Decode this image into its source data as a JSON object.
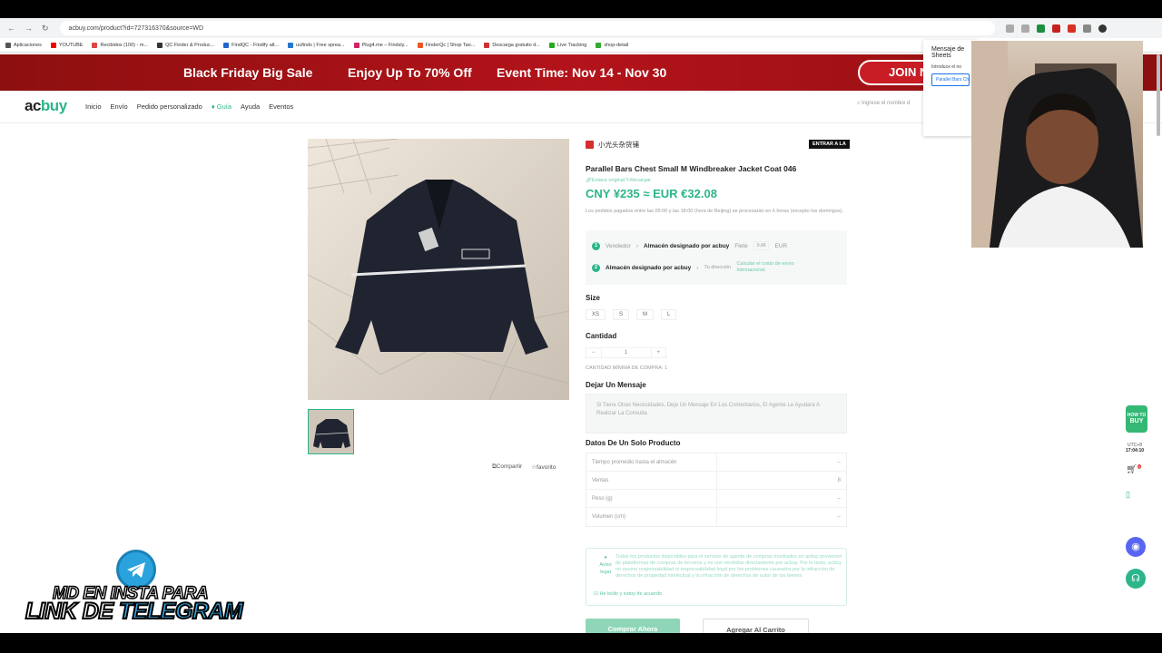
{
  "browser": {
    "url": "acbuy.com/product?id=727316370&source=WD",
    "bookmarks": [
      "Aplicaciones",
      "YOUTUBE",
      "Recibidos (100) - m...",
      "QC Finder & Produc...",
      "FindQC - Findify alt...",
      "uufinds | Free sprea...",
      "Plug4.me – Findsly...",
      "FinderQc | Shop Tao...",
      "Descarga gratuito d...",
      "Live Tracking",
      "shop-detail"
    ]
  },
  "banner": {
    "sale": "Black Friday Big Sale",
    "discount": "Enjoy Up To 70% Off",
    "event": "Event Time: Nov 14 - Nov 30",
    "join": "JOIN N"
  },
  "nav": {
    "logo_a": "ac",
    "logo_b": "buy",
    "items": [
      "Inicio",
      "Envío",
      "Pedido personalizado",
      "Guía",
      "Ayuda",
      "Eventos"
    ],
    "search_placeholder": "Ingrese el nombre d"
  },
  "product": {
    "store_name": "小光头杂货铺",
    "enter_store": "ENTRAR A LA",
    "title": "Parallel Bars Chest Small M Windbreaker Jacket Coat 046",
    "link_original": "Enlace original",
    "link_reload": "Recargar",
    "price": "CNY ¥235 ≈ EUR €32.08",
    "note": "Los pedidos pagados entre las 09:00 y las 18:00 (hora de Beijing) se procesarán en 6 horas (excepto los domingos).",
    "ship_row1": {
      "num": "1",
      "seller": "Vendedor",
      "warehouse": "Almacén designado por acbuy",
      "flete": "Flete",
      "amount": "0,48",
      "currency": "EUR"
    },
    "ship_row2": {
      "num": "2",
      "warehouse": "Almacén designado por acbuy",
      "dir": "Tu dirección",
      "calc": "Calcular el costo de envío internacional"
    },
    "size_label": "Size",
    "sizes": [
      "XS",
      "S",
      "M",
      "L"
    ],
    "qty_label": "Cantidad",
    "qty_minus": "−",
    "qty_value": "1",
    "qty_plus": "+",
    "min_qty": "CANTIDAD MÍNIMA DE COMPRA: 1",
    "msg_label": "Dejar Un Mensaje",
    "msg_placeholder": "Si Tiene Otras Necesidades, Deje Un Mensaje En Los Comentarios, El Agente Le Ayudará A Realizar La Consulta",
    "data_label": "Datos De Un Solo Producto",
    "data_rows": [
      {
        "k": "Tiempo promedio hasta el almacén",
        "v": "--"
      },
      {
        "k": "Ventas",
        "v": "8"
      },
      {
        "k": "Peso (g)",
        "v": "--"
      },
      {
        "k": "Volumen (cm)",
        "v": "--"
      }
    ],
    "legal_head": "Aviso legal",
    "legal_text": "Todos los productos disponibles para el servicio de agente de compras mostrados en acbuy provienen de plataformas de compras de terceros y no son vendidos directamente por acbuy. Por lo tanto, acbuy no asume responsabilidad ni responsabilidad legal por los problemas causados por la infracción de derechos de propiedad intelectual y la infracción de derechos de autor de los bienes.",
    "legal_check": "He leído y estoy de acuerdo",
    "buy_now": "Comprar Ahora",
    "add_cart": "Agregar Al Carrito",
    "share": "Compartir",
    "favorite": "favorito"
  },
  "popup": {
    "title": "Mensaje de Sheets",
    "sub": "Introduce el no",
    "input": "Parallel Bars Ch"
  },
  "side": {
    "tz": "UTC+8",
    "time": "17:04:10",
    "how_to": "HOW TO",
    "buy": "BUY",
    "cart_badge": "0"
  },
  "overlay": {
    "line1": "MD EN INSTA PARA",
    "line2a": "LINK DE ",
    "line2b": "TELEGRAM"
  }
}
